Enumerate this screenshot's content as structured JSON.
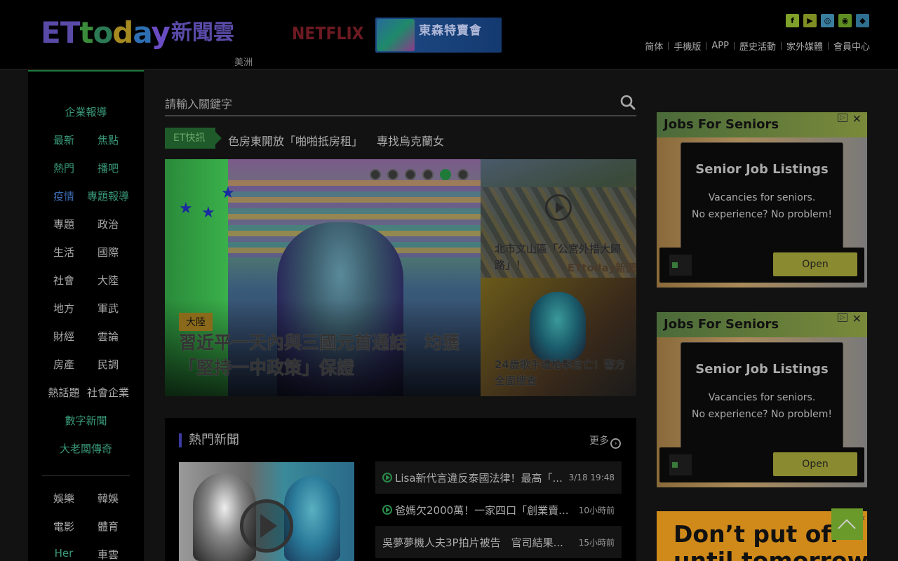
{
  "header": {
    "logo_latin": [
      "E",
      "T",
      "t",
      "o",
      "d",
      "a",
      "y"
    ],
    "logo_cn": "新聞雲",
    "region": "美洲",
    "netflix": "NETFLIX",
    "banner_text": "東森特賣會",
    "social": [
      "f",
      "▶",
      "◎",
      "◉",
      "◆"
    ],
    "nav": [
      "简体",
      "手機版",
      "APP",
      "歷史活動",
      "家外媒體",
      "會員中心"
    ]
  },
  "sidebar": {
    "top_link": "企業報導",
    "grid": [
      [
        "最新",
        "焦點"
      ],
      [
        "熱門",
        "播吧"
      ],
      [
        "疫情",
        "專題報導"
      ],
      [
        "專題",
        "政治"
      ],
      [
        "生活",
        "國際"
      ],
      [
        "社會",
        "大陸"
      ],
      [
        "地方",
        "軍武"
      ],
      [
        "財經",
        "雲論"
      ],
      [
        "房產",
        "民調"
      ],
      [
        "熱話題",
        "社會企業"
      ]
    ],
    "link_numbers": "數字新聞",
    "link_boss": "大老闆傳奇",
    "grid2": [
      [
        "娛樂",
        "韓娛"
      ],
      [
        "電影",
        "體育"
      ],
      [
        "Her",
        "車雲"
      ]
    ]
  },
  "search": {
    "placeholder": "請輸入關鍵字"
  },
  "flash": {
    "tag": "ET快訊",
    "items": [
      "色房東開放「啪啪抵房租」",
      "專找烏克蘭女"
    ]
  },
  "hero": {
    "category": "大陸",
    "title": "習近平一天內與三國元首通話　均獲「堅持一中政策」保證",
    "side1_caption": "北市文山區「公宮外措大歸路」！",
    "side1_watermark": "ETtoday新聞",
    "side2_caption": "24歲歌手遭槍擊身亡！警方全面搜查"
  },
  "hot": {
    "title": "熱門新聞",
    "more": "更多",
    "items": [
      {
        "text": "Lisa新代言違反泰國法律！最高「...",
        "time": "3/18 19:48",
        "video": true
      },
      {
        "text": "爸媽欠2000萬！一家四口「創業賣...",
        "time": "10小時前",
        "video": true
      },
      {
        "text": "吳夢夢機人夫3P拍片被告　官司結果...",
        "time": "15小時前",
        "video": false
      }
    ]
  },
  "ads": [
    {
      "header": "Jobs For Seniors",
      "heading": "Senior Job Listings",
      "line1": "Vacancies for seniors.",
      "line2": "No experience? No problem!",
      "button": "Open"
    },
    {
      "header": "Jobs For Seniors",
      "heading": "Senior Job Listings",
      "line1": "Vacancies for seniors.",
      "line2": "No experience? No problem!",
      "button": "Open"
    }
  ],
  "ad3": {
    "text1": "Don’t put off",
    "text2": "until tomorrow"
  }
}
